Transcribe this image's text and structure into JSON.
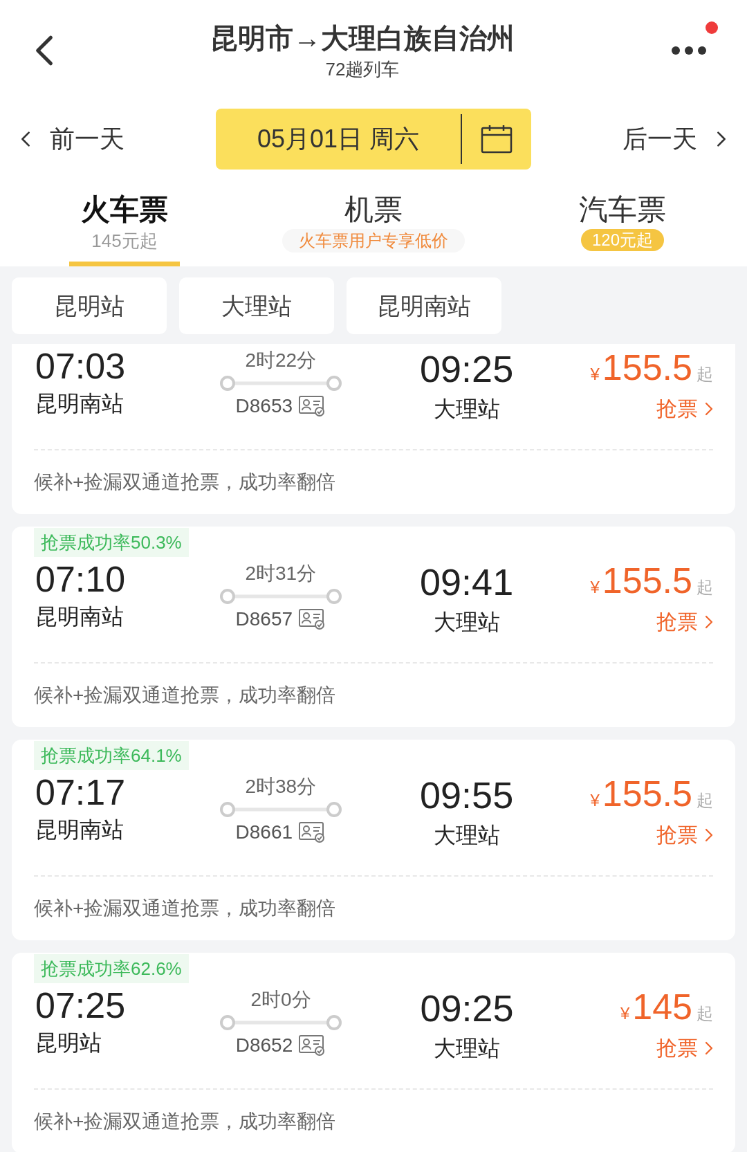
{
  "header": {
    "title": "昆明市→大理白族自治州",
    "subtitle": "72趟列车",
    "notification_dot": true
  },
  "date_bar": {
    "prev": "前一天",
    "date": "05月01日 周六",
    "next": "后一天"
  },
  "tabs": [
    {
      "label": "火车票",
      "note": {
        "kind": "plain",
        "text": "145元起"
      },
      "selected": true
    },
    {
      "label": "机票",
      "note": {
        "kind": "promo",
        "text": "火车票用户专享低价"
      },
      "selected": false
    },
    {
      "label": "汽车票",
      "note": {
        "kind": "pill",
        "text": "120元起"
      },
      "selected": false
    }
  ],
  "station_filters": [
    {
      "label": "昆明站",
      "selected": false
    },
    {
      "label": "大理站",
      "selected": false
    },
    {
      "label": "昆明南站",
      "selected": false
    }
  ],
  "trains": [
    {
      "depart": "07:03",
      "from": "昆明南站",
      "duration": "2时22分",
      "train": "D8653",
      "arrive": "09:25",
      "to": "大理站",
      "currency": "¥",
      "price": "155.5",
      "price_suffix": "起",
      "action": "抢票",
      "note": "候补+捡漏双通道抢票，成功率翻倍"
    },
    {
      "tag": "抢票成功率50.3%",
      "depart": "07:10",
      "from": "昆明南站",
      "duration": "2时31分",
      "train": "D8657",
      "arrive": "09:41",
      "to": "大理站",
      "currency": "¥",
      "price": "155.5",
      "price_suffix": "起",
      "action": "抢票",
      "note": "候补+捡漏双通道抢票，成功率翻倍"
    },
    {
      "tag": "抢票成功率64.1%",
      "depart": "07:17",
      "from": "昆明南站",
      "duration": "2时38分",
      "train": "D8661",
      "arrive": "09:55",
      "to": "大理站",
      "currency": "¥",
      "price": "155.5",
      "price_suffix": "起",
      "action": "抢票",
      "note": "候补+捡漏双通道抢票，成功率翻倍"
    },
    {
      "tag": "抢票成功率62.6%",
      "depart": "07:25",
      "from": "昆明站",
      "duration": "2时0分",
      "train": "D8652",
      "arrive": "09:25",
      "to": "大理站",
      "currency": "¥",
      "price": "145",
      "price_suffix": "起",
      "action": "抢票",
      "note": "候补+捡漏双通道抢票，成功率翻倍"
    }
  ]
}
